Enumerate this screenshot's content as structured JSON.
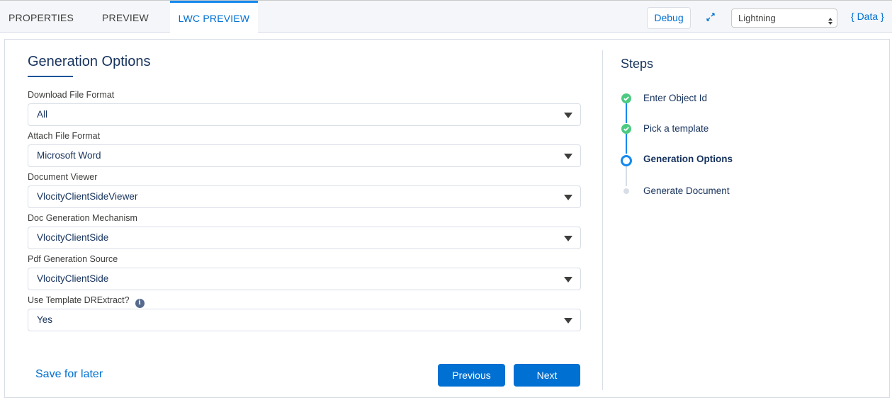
{
  "tabs": [
    {
      "label": "PROPERTIES"
    },
    {
      "label": "PREVIEW"
    },
    {
      "label": "LWC PREVIEW"
    }
  ],
  "toolbar": {
    "debug_label": "Debug",
    "platform_value": "Lightning",
    "data_link": "{ Data }"
  },
  "form": {
    "title": "Generation Options",
    "fields": [
      {
        "label": "Download File Format",
        "value": "All"
      },
      {
        "label": "Attach File Format",
        "value": "Microsoft Word"
      },
      {
        "label": "Document Viewer",
        "value": "VlocityClientSideViewer"
      },
      {
        "label": "Doc Generation Mechanism",
        "value": "VlocityClientSide"
      },
      {
        "label": "Pdf Generation Source",
        "value": "VlocityClientSide"
      },
      {
        "label": "Use Template DRExtract?",
        "value": "Yes"
      }
    ],
    "info_glyph": "i",
    "save_later": "Save for later",
    "previous": "Previous",
    "next": "Next"
  },
  "steps": {
    "title": "Steps",
    "items": [
      {
        "label": "Enter Object Id",
        "status": "complete"
      },
      {
        "label": "Pick a template",
        "status": "complete"
      },
      {
        "label": "Generation Options",
        "status": "active"
      },
      {
        "label": "Generate Document",
        "status": "incomplete"
      }
    ]
  },
  "colors": {
    "brand": "#0070d2",
    "complete": "#4bca81",
    "active": "#1589ee",
    "text": "#16325c"
  }
}
